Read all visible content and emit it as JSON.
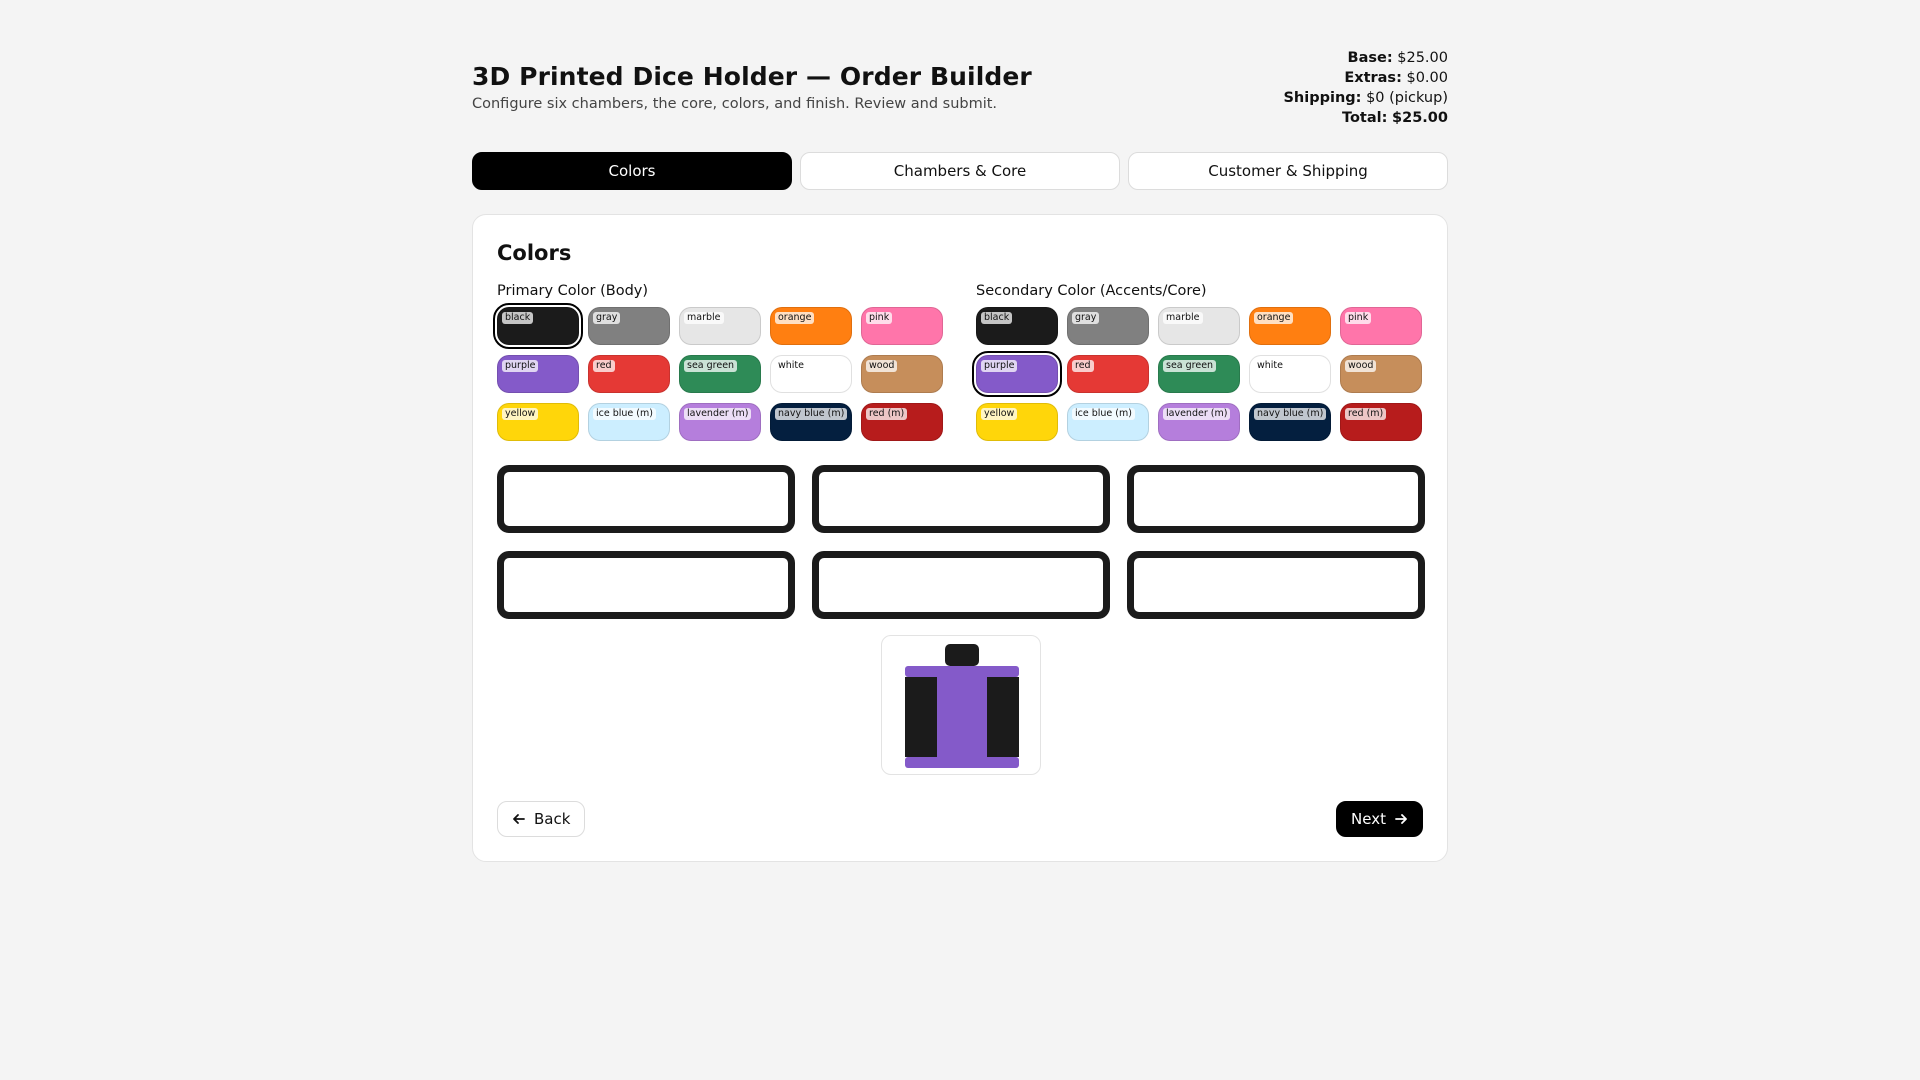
{
  "header": {
    "title": "3D Printed Dice Holder — Order Builder",
    "subtitle": "Configure six chambers, the core, colors, and finish. Review and submit."
  },
  "totals": {
    "base_label": "Base:",
    "base_value": "$25.00",
    "extras_label": "Extras:",
    "extras_value": "$0.00",
    "shipping_label": "Shipping:",
    "shipping_value": "$0 (pickup)",
    "total_label": "Total:",
    "total_value": "$25.00"
  },
  "tabs": [
    {
      "label": "Colors",
      "active": true
    },
    {
      "label": "Chambers & Core",
      "active": false
    },
    {
      "label": "Customer & Shipping",
      "active": false
    }
  ],
  "section": {
    "title": "Colors",
    "primary_label": "Primary Color (Body)",
    "secondary_label": "Secondary Color (Accents/Core)"
  },
  "colors": [
    {
      "name": "black",
      "hex": "#1b1b1b"
    },
    {
      "name": "gray",
      "hex": "#808080"
    },
    {
      "name": "marble",
      "hex": "#e6e6e6"
    },
    {
      "name": "orange",
      "hex": "#ff7f11"
    },
    {
      "name": "pink",
      "hex": "#ff75aa"
    },
    {
      "name": "purple",
      "hex": "#845ac9"
    },
    {
      "name": "red",
      "hex": "#e53935"
    },
    {
      "name": "sea green",
      "hex": "#2e8b57"
    },
    {
      "name": "white",
      "hex": "#ffffff"
    },
    {
      "name": "wood",
      "hex": "#c68e5b"
    },
    {
      "name": "yellow",
      "hex": "#ffd60a"
    },
    {
      "name": "ice blue (m)",
      "hex": "#cceeff"
    },
    {
      "name": "lavender (m)",
      "hex": "#b57edc"
    },
    {
      "name": "navy blue (m)",
      "hex": "#041f3f"
    },
    {
      "name": "red (m)",
      "hex": "#b71c1c"
    }
  ],
  "selection": {
    "primary": "black",
    "secondary": "purple"
  },
  "nav": {
    "back_label": "Back",
    "next_label": "Next"
  }
}
